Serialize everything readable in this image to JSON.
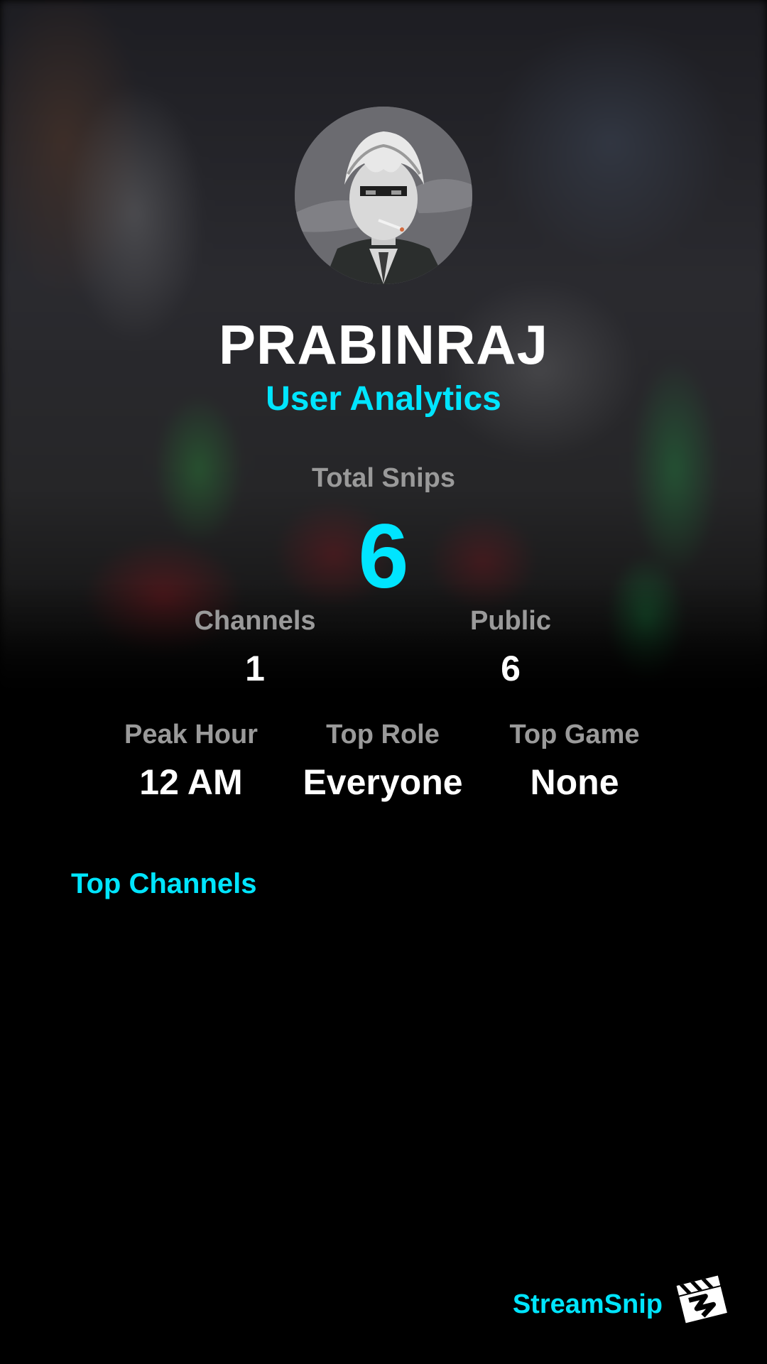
{
  "profile": {
    "username": "PRABINRAJ",
    "subtitle": "User Analytics"
  },
  "stats": {
    "total_snips_label": "Total Snips",
    "total_snips_value": "6",
    "channels_label": "Channels",
    "channels_value": "1",
    "public_label": "Public",
    "public_value": "6",
    "peak_hour_label": "Peak Hour",
    "peak_hour_value": "12 AM",
    "top_role_label": "Top Role",
    "top_role_value": "Everyone",
    "top_game_label": "Top Game",
    "top_game_value": "None"
  },
  "sections": {
    "top_channels_title": "Top Channels"
  },
  "footer": {
    "brand": "StreamSnip",
    "logo_icon": "clapperboard-icon"
  },
  "colors": {
    "accent": "#00e5ff",
    "label_gray": "#9a9a9a",
    "background": "#000000"
  }
}
